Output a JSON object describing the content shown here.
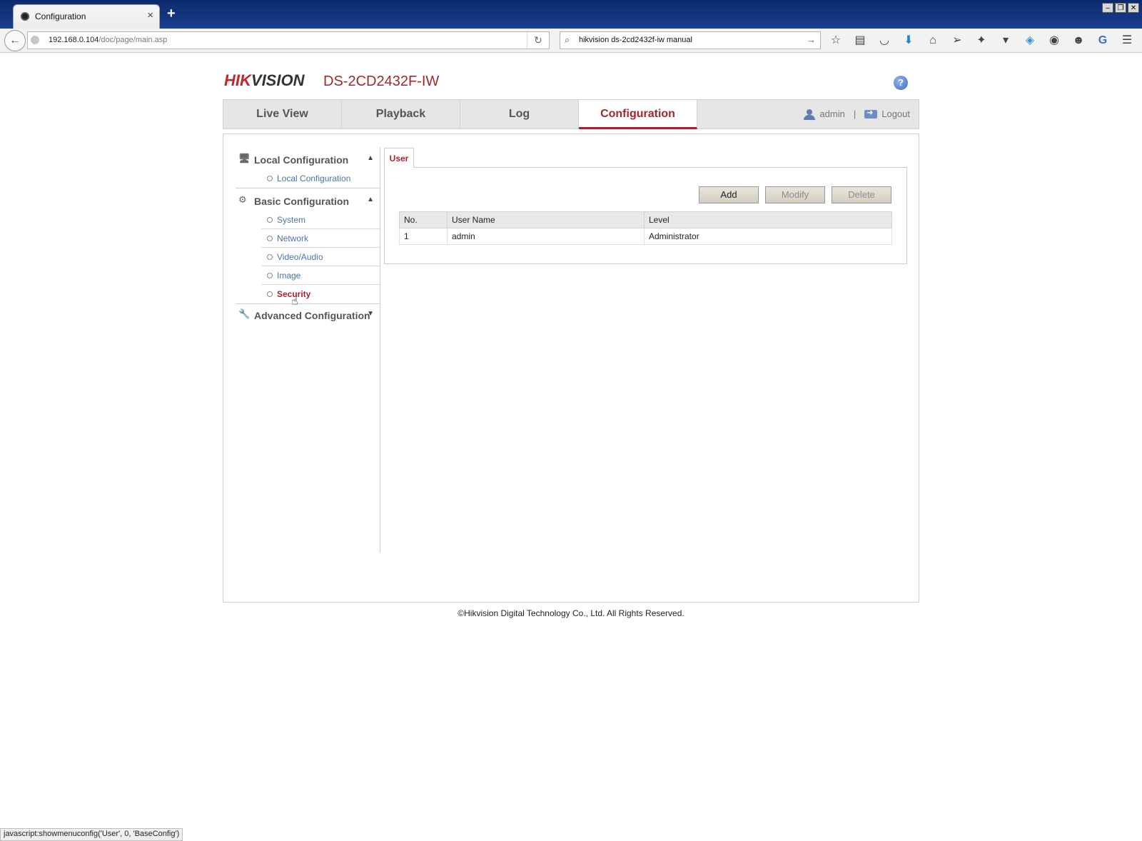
{
  "browser": {
    "tab_title": "Configuration",
    "tab_close": "×",
    "new_tab": "+",
    "url_host": "192.168.0.104",
    "url_path": "/doc/page/main.asp",
    "search_value": "hikvision ds-2cd2432f-iw manual",
    "status_text": "javascript:showmenuconfig('User', 0, 'BaseConfig')"
  },
  "header": {
    "logo_prefix": "HIK",
    "logo_suffix": "VISION",
    "model": "DS-2CD2432F-IW",
    "help": "?"
  },
  "topnav": {
    "tabs": [
      {
        "label": "Live View"
      },
      {
        "label": "Playback"
      },
      {
        "label": "Log"
      },
      {
        "label": "Configuration"
      }
    ],
    "user": "admin",
    "separator": "|",
    "logout": "Logout"
  },
  "sidebar": {
    "sections": [
      {
        "label": "Local Configuration",
        "items": [
          "Local Configuration"
        ]
      },
      {
        "label": "Basic Configuration",
        "items": [
          "System",
          "Network",
          "Video/Audio",
          "Image",
          "Security"
        ]
      },
      {
        "label": "Advanced Configuration",
        "items": []
      }
    ],
    "active_item": "Security"
  },
  "content": {
    "tab": "User",
    "buttons": {
      "add": "Add",
      "modify": "Modify",
      "delete": "Delete"
    },
    "table": {
      "headers": [
        "No.",
        "User Name",
        "Level"
      ],
      "rows": [
        [
          "1",
          "admin",
          "Administrator"
        ]
      ]
    }
  },
  "footer": "©Hikvision Digital Technology Co., Ltd. All Rights Reserved.",
  "colors": {
    "accent": "#a4262c",
    "link": "#4a74a8"
  }
}
